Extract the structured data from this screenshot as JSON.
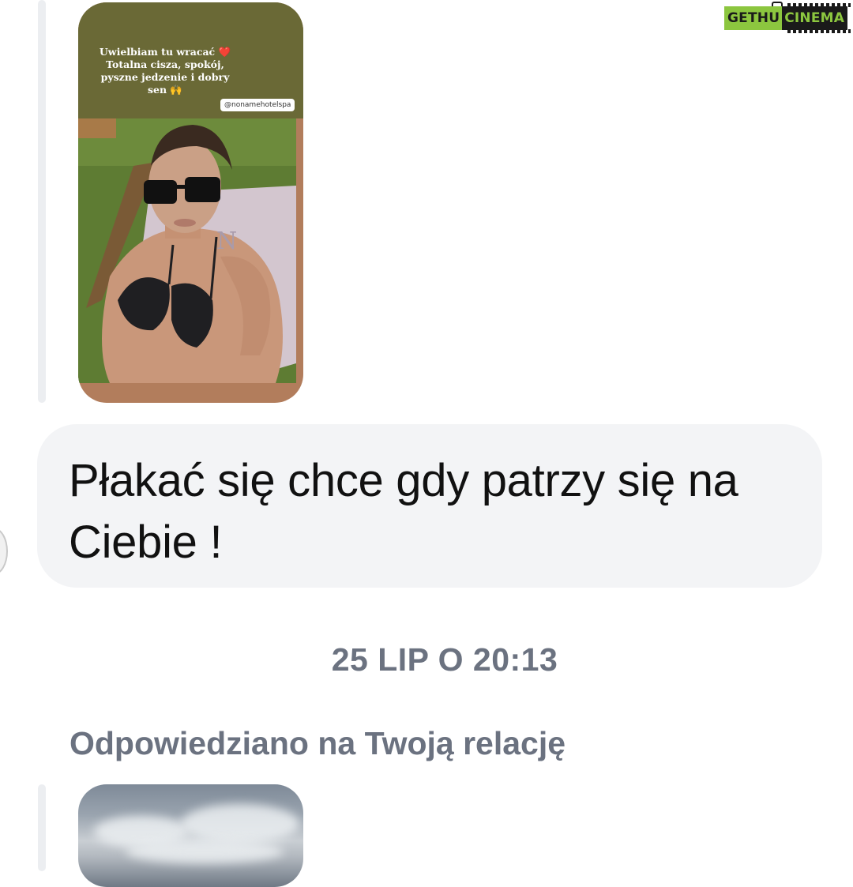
{
  "watermark": {
    "left_text": "GETHU",
    "right_text": "CINEMA",
    "icon": "camera-icon",
    "colors": {
      "green": "#8cc63f",
      "dark": "#1a1a1a"
    }
  },
  "story_1": {
    "caption": "Uwielbiam tu wracać ❤️\nTotalna cisza, spokój,\npyszne jedzenie i dobry\nsen 🙌",
    "tag": "@nonamehotelspa",
    "colors": {
      "top": "#6a6936",
      "bottom": "#b27d5c"
    }
  },
  "message": {
    "text": "Płakać się chce gdy patrzy się na\nCiebie !",
    "bubble_color": "#f3f4f6"
  },
  "timestamp": "25 LIP O 20:13",
  "reply_label": "Odpowiedziano na Twoją relację",
  "colors": {
    "muted_text": "#6b7280",
    "thread_line": "#eceef1"
  }
}
